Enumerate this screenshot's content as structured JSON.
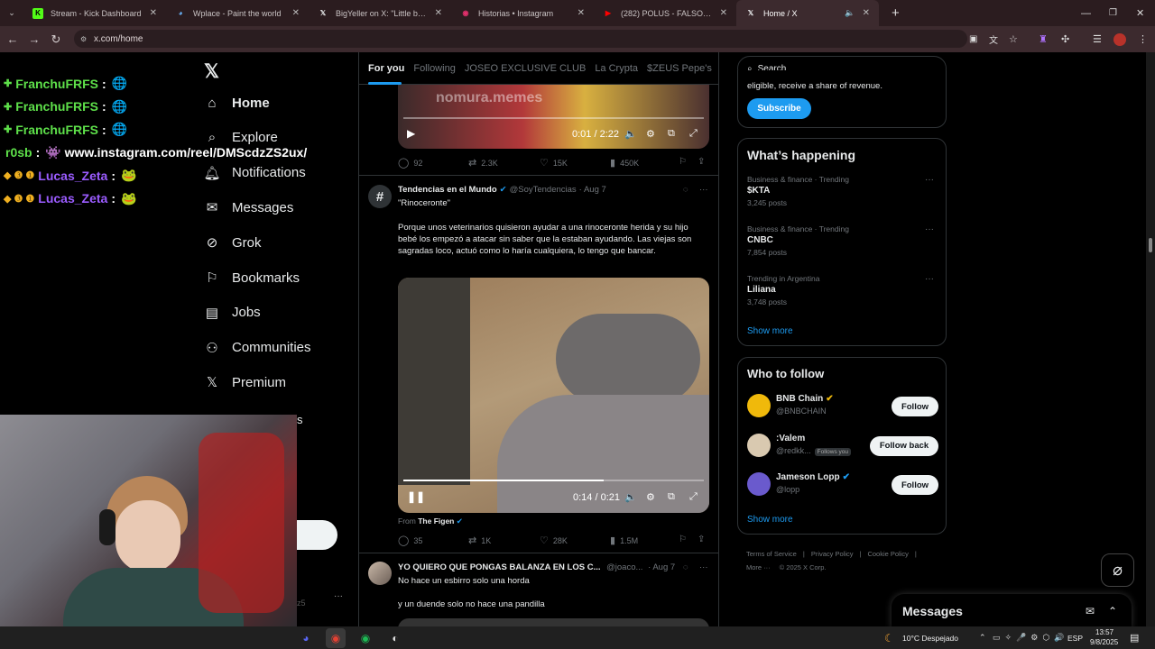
{
  "tabs": [
    {
      "title": "Stream - Kick Dashboard",
      "fav": "K",
      "color": "#53fc18"
    },
    {
      "title": "Wplace - Paint the world",
      "fav": "◕",
      "color": "#6ab7ff"
    },
    {
      "title": "BigYeller on X: \"Little boogie lo",
      "fav": "𝕏",
      "color": "#e7e9ea"
    },
    {
      "title": "Historias • Instagram",
      "fav": "◉",
      "color": "#e1306c"
    },
    {
      "title": "(282) POLUS - FALSO NEGRO /",
      "fav": "▶",
      "color": "#ff0000"
    },
    {
      "title": "Home / X",
      "fav": "𝕏",
      "color": "#e7e9ea"
    }
  ],
  "url": "x.com/home",
  "chat": [
    {
      "user": "FranchuFRFS",
      "color": "#5ee04a",
      "prefix": "✚",
      "msg": "🌐",
      "msg_color": "#4aa3ff"
    },
    {
      "user": "FranchuFRFS",
      "color": "#5ee04a",
      "prefix": "✚",
      "msg": "🌐",
      "msg_color": "#4aa3ff"
    },
    {
      "user": "FranchuFRFS",
      "color": "#5ee04a",
      "prefix": "✚",
      "msg": "🌐",
      "msg_color": "#4aa3ff"
    },
    {
      "user": "r0sb",
      "color": "#5ee04a",
      "prefix": "",
      "msg": "👾 www.instagram.com/reel/DMScdzZS2ux/",
      "msg_color": "#ffffff"
    },
    {
      "user": "Lucas_Zeta",
      "color": "#9b5cff",
      "prefix": "◆ ❸ ❶",
      "msg": "🐸",
      "msg_color": "#5a8a3a"
    },
    {
      "user": "Lucas_Zeta",
      "color": "#9b5cff",
      "prefix": "◆ ❸ ❶",
      "msg": "🐸",
      "msg_color": "#5a8a3a"
    }
  ],
  "nav": [
    "Home",
    "Explore",
    "Notifications",
    "Messages",
    "Grok",
    "Bookmarks",
    "Jobs",
    "Communities",
    "Premium"
  ],
  "nav_partial": "s",
  "feed_tabs": [
    "For you",
    "Following",
    "JOSEO EXCLUSIVE CLUB",
    "La Crypta",
    "$ZEUS Pepe's"
  ],
  "video1": {
    "watermark": "nomura.memes",
    "time": "0:01 / 2:22"
  },
  "post1_actions": {
    "replies": "92",
    "reposts": "2.3K",
    "likes": "15K",
    "views": "450K"
  },
  "post2": {
    "name": "Tendencias en el Mundo",
    "handle": "@SoyTendencias",
    "date": "· Aug 7",
    "title": "\"Rinoceronte\"",
    "body": "Porque unos veterinarios quisieron ayudar a una rinoceronte herida y su hijo bebé los empezó a atacar sin saber que la estaban ayudando. Las viejas son sagradas loco, actuó como lo haría cualquiera, lo tengo que bancar.",
    "time": "0:14 / 0:21",
    "from_label": "From",
    "from_name": "The Figen",
    "replies": "35",
    "reposts": "1K",
    "likes": "28K",
    "views": "1.5M"
  },
  "post3": {
    "name": "YO QUIERO QUE PONGAS BALANZA EN LOS C...",
    "handle": "@joaco...",
    "date": "· Aug 7",
    "line1": "No hace un esbirro solo una horda",
    "line2": "y un duende solo no hace una pandilla"
  },
  "search_placeholder": "Search",
  "premium": {
    "text": "eligible, receive a share of revenue.",
    "button": "Subscribe"
  },
  "happening": {
    "title": "What’s happening",
    "items": [
      {
        "meta": "Business & finance · Trending",
        "name": "$KTA",
        "posts": "3,245 posts"
      },
      {
        "meta": "Business & finance · Trending",
        "name": "CNBC",
        "posts": "7,854 posts"
      },
      {
        "meta": "Trending in Argentina",
        "name": "Liliana",
        "posts": "3,748 posts"
      }
    ],
    "show_more": "Show more"
  },
  "follow": {
    "title": "Who to follow",
    "items": [
      {
        "name": "BNB Chain",
        "handle": "@BNBCHAIN",
        "button": "Follow",
        "badge": ""
      },
      {
        "name": ":Valem",
        "handle": "@redkk...",
        "button": "Follow back",
        "badge": "Follows you"
      },
      {
        "name": "Jameson Lopp",
        "handle": "@lopp",
        "button": "Follow",
        "badge": ""
      }
    ],
    "show_more": "Show more"
  },
  "footer": {
    "links": [
      "Terms of Service",
      "|",
      "Privacy Policy",
      "|",
      "Cookie Policy",
      "|"
    ],
    "more": "More ···",
    "copy": "© 2025 X Corp."
  },
  "messages_drawer": "Messages",
  "taskbar": {
    "weather": "10°C  Despejado",
    "lang": "ESP",
    "time": "13:57",
    "date": "9/8/2025"
  }
}
